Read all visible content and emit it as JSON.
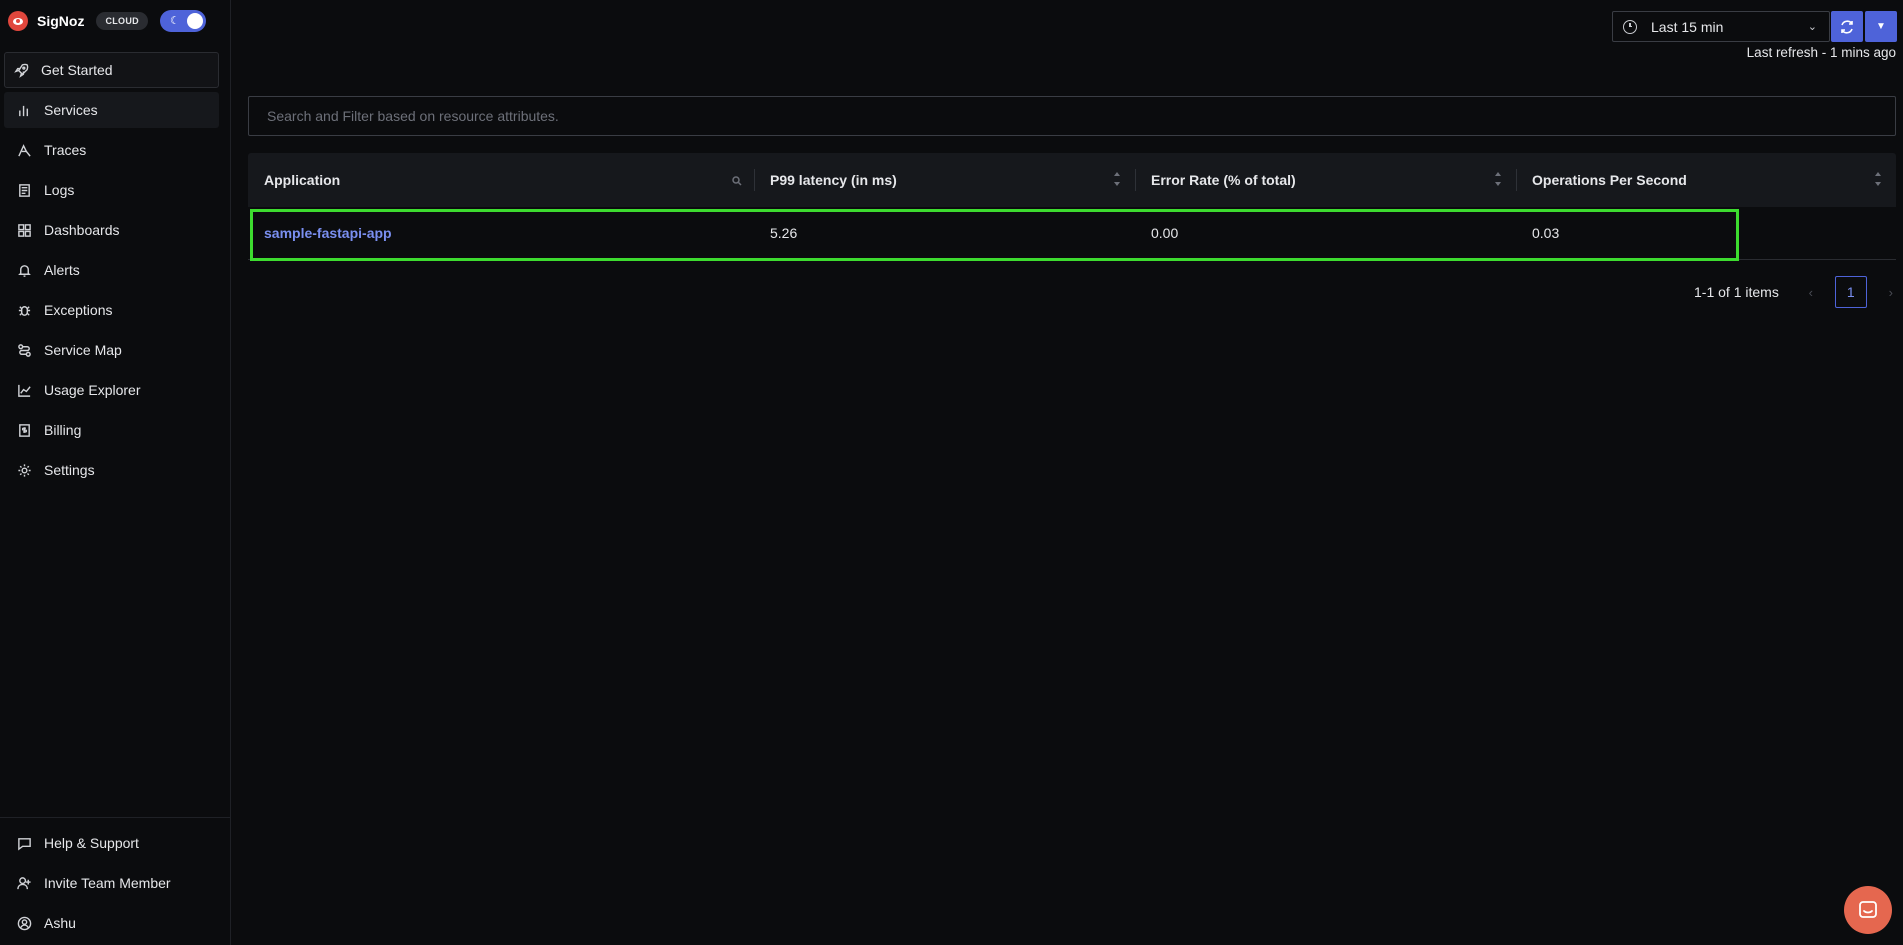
{
  "brand": {
    "name": "SigNoz",
    "badge": "CLOUD"
  },
  "sidebar": {
    "items": [
      {
        "label": "Get Started",
        "icon": "rocket-icon"
      },
      {
        "label": "Services",
        "icon": "bar-chart-icon"
      },
      {
        "label": "Traces",
        "icon": "traces-icon"
      },
      {
        "label": "Logs",
        "icon": "logs-icon"
      },
      {
        "label": "Dashboards",
        "icon": "dashboard-icon"
      },
      {
        "label": "Alerts",
        "icon": "bell-icon"
      },
      {
        "label": "Exceptions",
        "icon": "bug-icon"
      },
      {
        "label": "Service Map",
        "icon": "route-icon"
      },
      {
        "label": "Usage Explorer",
        "icon": "line-chart-icon"
      },
      {
        "label": "Billing",
        "icon": "billing-icon"
      },
      {
        "label": "Settings",
        "icon": "gear-icon"
      }
    ],
    "bottom": [
      {
        "label": "Help & Support",
        "icon": "message-icon"
      },
      {
        "label": "Invite Team Member",
        "icon": "user-add-icon"
      },
      {
        "label": "Ashu",
        "icon": "user-circle-icon"
      }
    ]
  },
  "topbar": {
    "time_range": "Last 15 min",
    "last_refresh": "Last refresh - 1 mins ago"
  },
  "search": {
    "placeholder": "Search and Filter based on resource attributes."
  },
  "table": {
    "columns": [
      "Application",
      "P99 latency (in ms)",
      "Error Rate (% of total)",
      "Operations Per Second"
    ],
    "rows": [
      {
        "application": "sample-fastapi-app",
        "p99": "5.26",
        "error_rate": "0.00",
        "ops": "0.03"
      }
    ]
  },
  "pagination": {
    "total_text": "1-1 of 1 items",
    "current_page": "1"
  },
  "colors": {
    "accent": "#4e63d9",
    "link": "#7a8ff0",
    "highlight": "#3ddc2f",
    "chat": "#e5674f"
  }
}
